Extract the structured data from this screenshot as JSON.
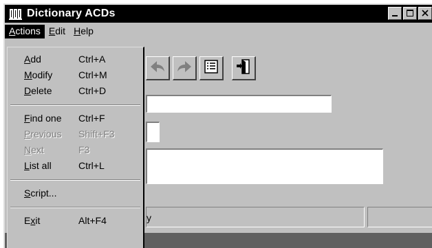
{
  "window": {
    "title": "Dictionary ACDs"
  },
  "menubar": {
    "items": [
      {
        "label": "Actions",
        "underline": "A",
        "active": true
      },
      {
        "label": "Edit",
        "underline": "E",
        "active": false
      },
      {
        "label": "Help",
        "underline": "H",
        "active": false
      }
    ]
  },
  "dropdown": {
    "items": [
      {
        "label": "Add",
        "u": "A",
        "rest": "dd",
        "shortcut": "Ctrl+A",
        "disabled": false
      },
      {
        "label": "Modify",
        "u": "M",
        "rest": "odify",
        "shortcut": "Ctrl+M",
        "disabled": false
      },
      {
        "label": "Delete",
        "u": "D",
        "rest": "elete",
        "shortcut": "Ctrl+D",
        "disabled": false
      },
      {
        "label": "Find one",
        "u": "F",
        "rest": "ind one",
        "shortcut": "Ctrl+F",
        "disabled": false
      },
      {
        "label": "Previous",
        "u": "P",
        "rest": "revious",
        "shortcut": "Shift+F3",
        "disabled": true
      },
      {
        "label": "Next",
        "u": "N",
        "rest": "ext",
        "shortcut": "F3",
        "disabled": true
      },
      {
        "label": "List all",
        "u": "L",
        "rest": "ist all",
        "shortcut": "Ctrl+L",
        "disabled": false
      },
      {
        "label": "Script...",
        "u": "S",
        "rest": "cript...",
        "shortcut": "",
        "disabled": false
      },
      {
        "label": "Exit",
        "u": "x",
        "pre": "E",
        "rest": "it",
        "shortcut": "Alt+F4",
        "disabled": false
      }
    ]
  },
  "statusbar": {
    "text": "y"
  },
  "colors": {
    "titlebar": "#000000",
    "face": "#c0c0c0",
    "highlight": "#000000"
  }
}
